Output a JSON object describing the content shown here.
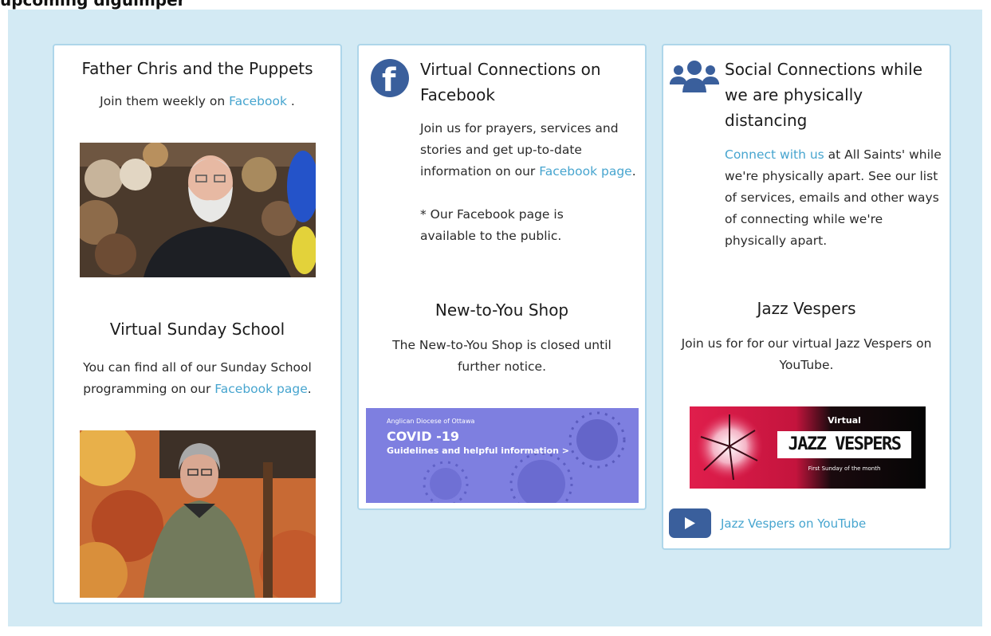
{
  "top_text": "upcoming diguimper",
  "card1": {
    "title": "Father Chris and the Puppets",
    "text_before": "Join them weekly on ",
    "link": "Facebook",
    "text_after": " .",
    "section_title": "Virtual Sunday School",
    "section_text_before": "You can find all of our Sunday School programming on our ",
    "section_link": "Facebook page",
    "section_text_after": "."
  },
  "card2": {
    "title": "Virtual Connections on Facebook",
    "text_before": "Join us for prayers, services and stories and get up-to-date information on our ",
    "link": "Facebook page",
    "text_after": ".",
    "note": "* Our Facebook page is available to the public.",
    "section_title": "New-to-You Shop",
    "section_text": "The New-to-You Shop is closed until further notice.",
    "banner": {
      "org": "Anglican Diocese of Ottawa",
      "headline": "COVID -19",
      "subline": "Guidelines and helpful information >"
    }
  },
  "card3": {
    "title": "Social Connections while we are physically distancing",
    "link": "Connect with us",
    "text_after": " at All Saints' while we're physically apart. See our list of services, emails and other ways of connecting while we're physically apart.",
    "section_title": "Jazz Vespers",
    "section_text": "Join us for for our virtual Jazz Vespers on YouTube.",
    "banner": {
      "kicker": "Virtual",
      "headline": "JAZZ VESPERS",
      "subline": "First Sunday of the month"
    },
    "youtube_link": "Jazz Vespers on YouTube"
  },
  "icons": [
    "facebook-icon",
    "people-group-icon",
    "youtube-play-icon"
  ],
  "colors": {
    "panel": "#d3eaf4",
    "border": "#aed6ea",
    "link": "#47a5cf",
    "icon_blue": "#3a5f9c"
  }
}
